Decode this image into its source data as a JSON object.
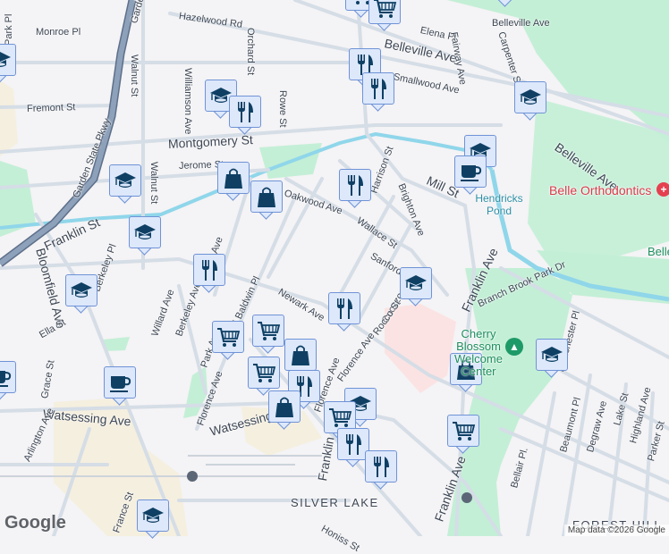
{
  "map": {
    "colors": {
      "background": "#f4f3f5",
      "road": "#d5dde6",
      "highway": "#7f93ad",
      "water": "#8fd6ea",
      "park": "#c3efd6",
      "marker_fill": "#dde8fb",
      "marker_border": "#6f93d6",
      "icon": "#0f4064"
    },
    "streets": [
      "Hazelwood Rd",
      "Monroe Pl",
      "Park Pl",
      "Garden St",
      "Walnut St",
      "Orchard St",
      "Fremont St",
      "Garden State Pkwy",
      "Williamson Ave",
      "Rowe St",
      "Montgomery St",
      "Jerome St",
      "Walnut St",
      "Belleville Ave",
      "Oakwood Ave",
      "Franklin St",
      "Bloomfield Ave",
      "Berkeley Pl",
      "Weaver Ave",
      "Newark Ave",
      "Ella St",
      "Willard Ave",
      "Berkeley Ave",
      "E Baldwin Pl",
      "Grace St",
      "Park Ave",
      "Florence Ave",
      "Watsessing Ave",
      "Arlington Ave",
      "Watsessing Ave",
      "Florence Ave",
      "Franklin St",
      "France St",
      "Elena Pl",
      "Fairway Ave",
      "Carpenter St",
      "Belleville Ave",
      "Smallwood Ave",
      "Mill St",
      "Harrison St",
      "Brighton Ave",
      "Wallace St",
      "Sanford St",
      "Belleville Ave",
      "Franklin Ave",
      "Branch Brook Park Dr",
      "Cuozzo St",
      "Rocco St",
      "Manchester Pl",
      "Beaumont Pl",
      "Degraw Ave",
      "Lake St",
      "Highland Ave",
      "Parker St",
      "Bellair Pl.",
      "Franklin Ave",
      "Honiss St",
      "Florence Ave"
    ],
    "areas": [
      "SILVER LAKE",
      "FOREST HILL"
    ],
    "water_label": "Hendricks Pond",
    "poi_red": "Belle Orthodontics",
    "poi_green": "Cherry Blossom Welcome Center",
    "poi_partial": "Belle",
    "markers": [
      "school",
      "restaurant",
      "school",
      "shopping",
      "shopping",
      "school",
      "restaurant",
      "school",
      "coffee",
      "school",
      "cart",
      "cart",
      "school",
      "coffee",
      "restaurant",
      "shopping",
      "cart",
      "restaurant",
      "shopping",
      "school",
      "cart",
      "restaurant",
      "restaurant",
      "school",
      "shopping",
      "cart",
      "school",
      "restaurant",
      "restaurant",
      "restaurant",
      "school",
      "school",
      "coffee",
      "cart",
      "cart",
      "school"
    ],
    "logo": "Google",
    "attribution": "Map data ©2026 Google"
  }
}
